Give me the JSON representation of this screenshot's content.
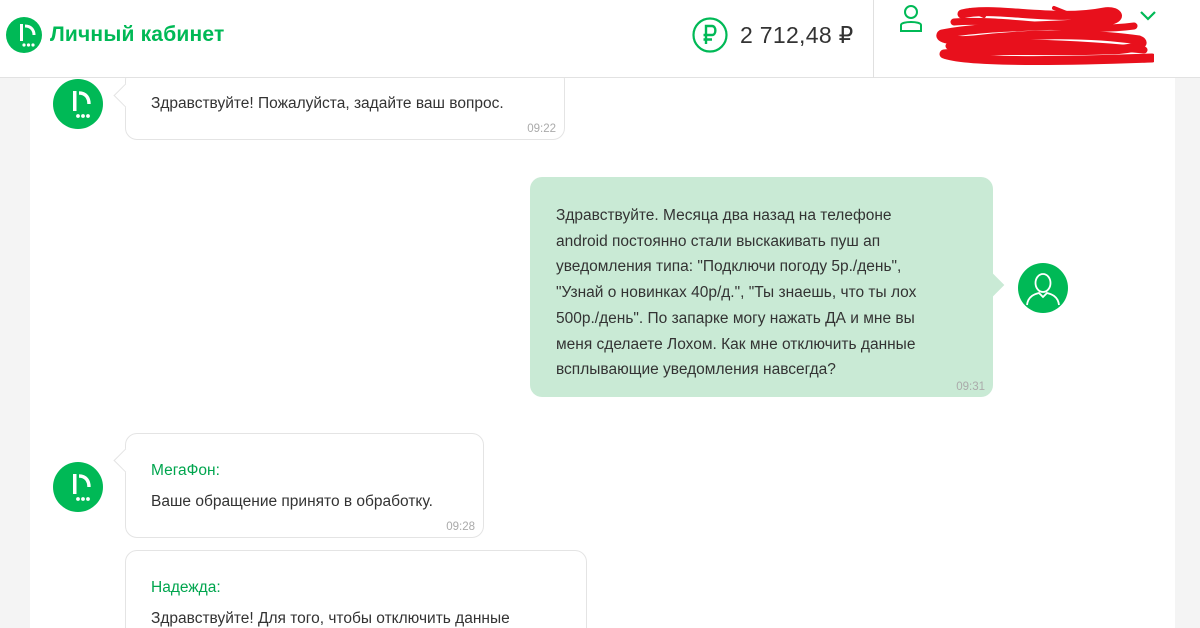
{
  "header": {
    "brand": "Личный кабинет",
    "balance": "2 712,48 ₽",
    "balance_currency_icon": "ruble-icon",
    "user_icon": "user-icon",
    "user_menu_icon": "chevron-down-icon"
  },
  "colors": {
    "brand_green": "#00b956",
    "outgoing_bubble": "#c9ead5",
    "redaction": "#e8101c"
  },
  "messages": [
    {
      "direction": "in",
      "author": "",
      "text": "Здравствуйте! Пожалуйста, задайте ваш вопрос.",
      "time": "09:22"
    },
    {
      "direction": "out",
      "lines": [
        "Здравствуйте. Месяца два назад на телефоне",
        "android постоянно стали выскакивать пуш ап",
        "уведомления типа: \"Подключи погоду 5р./день\",",
        "\"Узнай о новинках 40р/д.\", \"Ты знаешь, что ты лох",
        "500р./день\". По запарке могу нажать ДА и мне вы",
        "меня сделаете Лохом. Как мне отключить данные",
        "всплывающие уведомления навсегда?"
      ],
      "time": "09:31"
    },
    {
      "direction": "in",
      "author": "МегаФон:",
      "text": "Ваше обращение принято в обработку.",
      "time": "09:28"
    },
    {
      "direction": "in",
      "author": "Надежда:",
      "text": "Здравствуйте! Для того, чтобы отключить данные",
      "time": ""
    }
  ]
}
